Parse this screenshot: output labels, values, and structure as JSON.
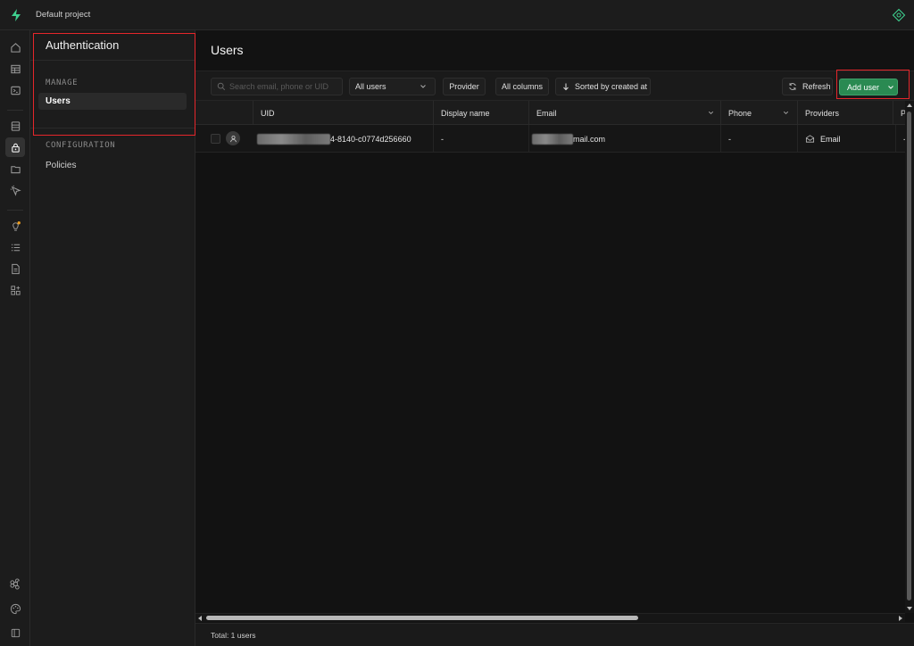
{
  "topbar": {
    "project_name": "Default project"
  },
  "sidebar": {
    "title": "Authentication",
    "manage_heading": "MANAGE",
    "manage_items": [
      {
        "label": "Users",
        "active": true
      }
    ],
    "configuration_heading": "CONFIGURATION",
    "configuration_items": [
      {
        "label": "Policies"
      }
    ]
  },
  "main": {
    "title": "Users",
    "toolbar": {
      "search_placeholder": "Search email, phone or UID",
      "filter_value": "All users",
      "provider_label": "Provider",
      "columns_label": "All columns",
      "sort_label": "Sorted by created at",
      "refresh_label": "Refresh",
      "add_user_label": "Add user"
    },
    "table": {
      "columns": [
        "UID",
        "Display name",
        "Email",
        "Phone",
        "Providers",
        "P"
      ],
      "rows": [
        {
          "uid_visible": "4-8140-c0774d256660",
          "display_name": "-",
          "email_visible": "mail.com",
          "phone": "-",
          "provider": "Email",
          "p": "-"
        }
      ]
    },
    "footer": {
      "total": "Total: 1 users"
    }
  },
  "colors": {
    "accent_green": "#2a8a52",
    "highlight_red": "#e5262b",
    "background": "#121212"
  }
}
